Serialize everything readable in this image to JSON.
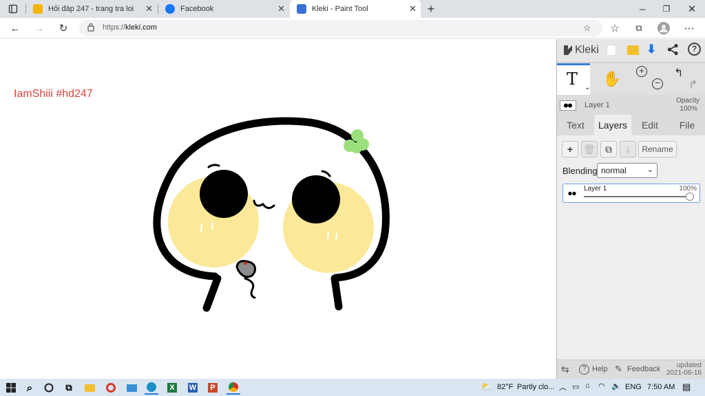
{
  "browser": {
    "tabs": [
      {
        "title": "Hỏi đáp 247 - trang tra loi"
      },
      {
        "title": "Facebook"
      },
      {
        "title": "Kleki - Paint Tool"
      }
    ],
    "url_prefix": "https://",
    "url_host": "kleki.com"
  },
  "canvas": {
    "credit": "IamShiii #hd247"
  },
  "panel": {
    "logo": "Kleki",
    "layer_name": "Layer 1",
    "opacity_label": "Opacity",
    "opacity_value": "100%",
    "tabs": [
      "Text",
      "Layers",
      "Edit",
      "File"
    ],
    "rename_label": "Rename",
    "blending_label": "Blending",
    "blending_value": "normal",
    "layer_row": {
      "name": "Layer 1",
      "opacity": "100%",
      "opacity_fraction": 1.0
    },
    "help_label": "Help",
    "feedback_label": "Feedback",
    "updated_label": "updated",
    "updated_date": "2021-06-16"
  },
  "taskbar": {
    "temperature": "82°F",
    "weather": "Partly clo...",
    "language": "ENG",
    "time": "7:50 AM"
  },
  "colors": {
    "tabbar": "#dee1e6",
    "accent": "#3b7ed6",
    "credit": "#d9443a",
    "cheek": "#fbe999",
    "sprout": "#9be07d"
  }
}
